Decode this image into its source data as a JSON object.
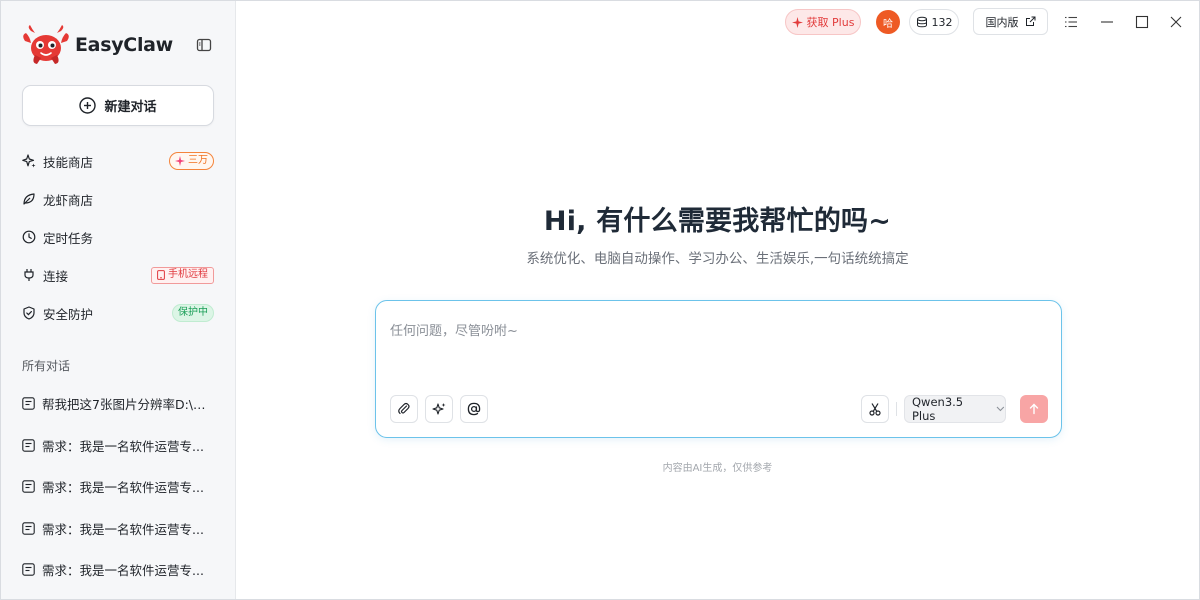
{
  "colors": {
    "accent": "#ee5a24",
    "plus_red": "#e23b3b",
    "composer_border": "#6cc3ea",
    "send_disabled": "#f8a5a5"
  },
  "brand": {
    "name": "EasyClaw"
  },
  "sidebar": {
    "new_chat_label": "新建对话",
    "nav": [
      {
        "label": "技能商店",
        "icon": "sparkle-icon",
        "badge": "三万"
      },
      {
        "label": "龙虾商店",
        "icon": "leaf-icon"
      },
      {
        "label": "定时任务",
        "icon": "clock-icon"
      },
      {
        "label": "连接",
        "icon": "plug-icon",
        "badge": "手机远程"
      },
      {
        "label": "安全防护",
        "icon": "shield-icon",
        "badge": "保护中"
      }
    ],
    "section_title": "所有对话",
    "conversations": [
      "帮我把这7张图片分辨率D:\\工...",
      "需求：我是一名软件运营专...",
      "需求：我是一名软件运营专...",
      "需求：我是一名软件运营专...",
      "需求：我是一名软件运营专..."
    ]
  },
  "topbar": {
    "get_plus_label": "获取 Plus",
    "avatar_text": "哈",
    "credits": "132",
    "region_label": "国内版"
  },
  "main": {
    "greeting": "Hi, 有什么需要我帮忙的吗~",
    "subtitle": "系统优化、电脑自动操作、学习办公、生活娱乐,一句话统统搞定",
    "input_placeholder": "任何问题，尽管吩咐~",
    "model": "Qwen3.5 Plus",
    "disclaimer": "内容由AI生成，仅供参考"
  }
}
